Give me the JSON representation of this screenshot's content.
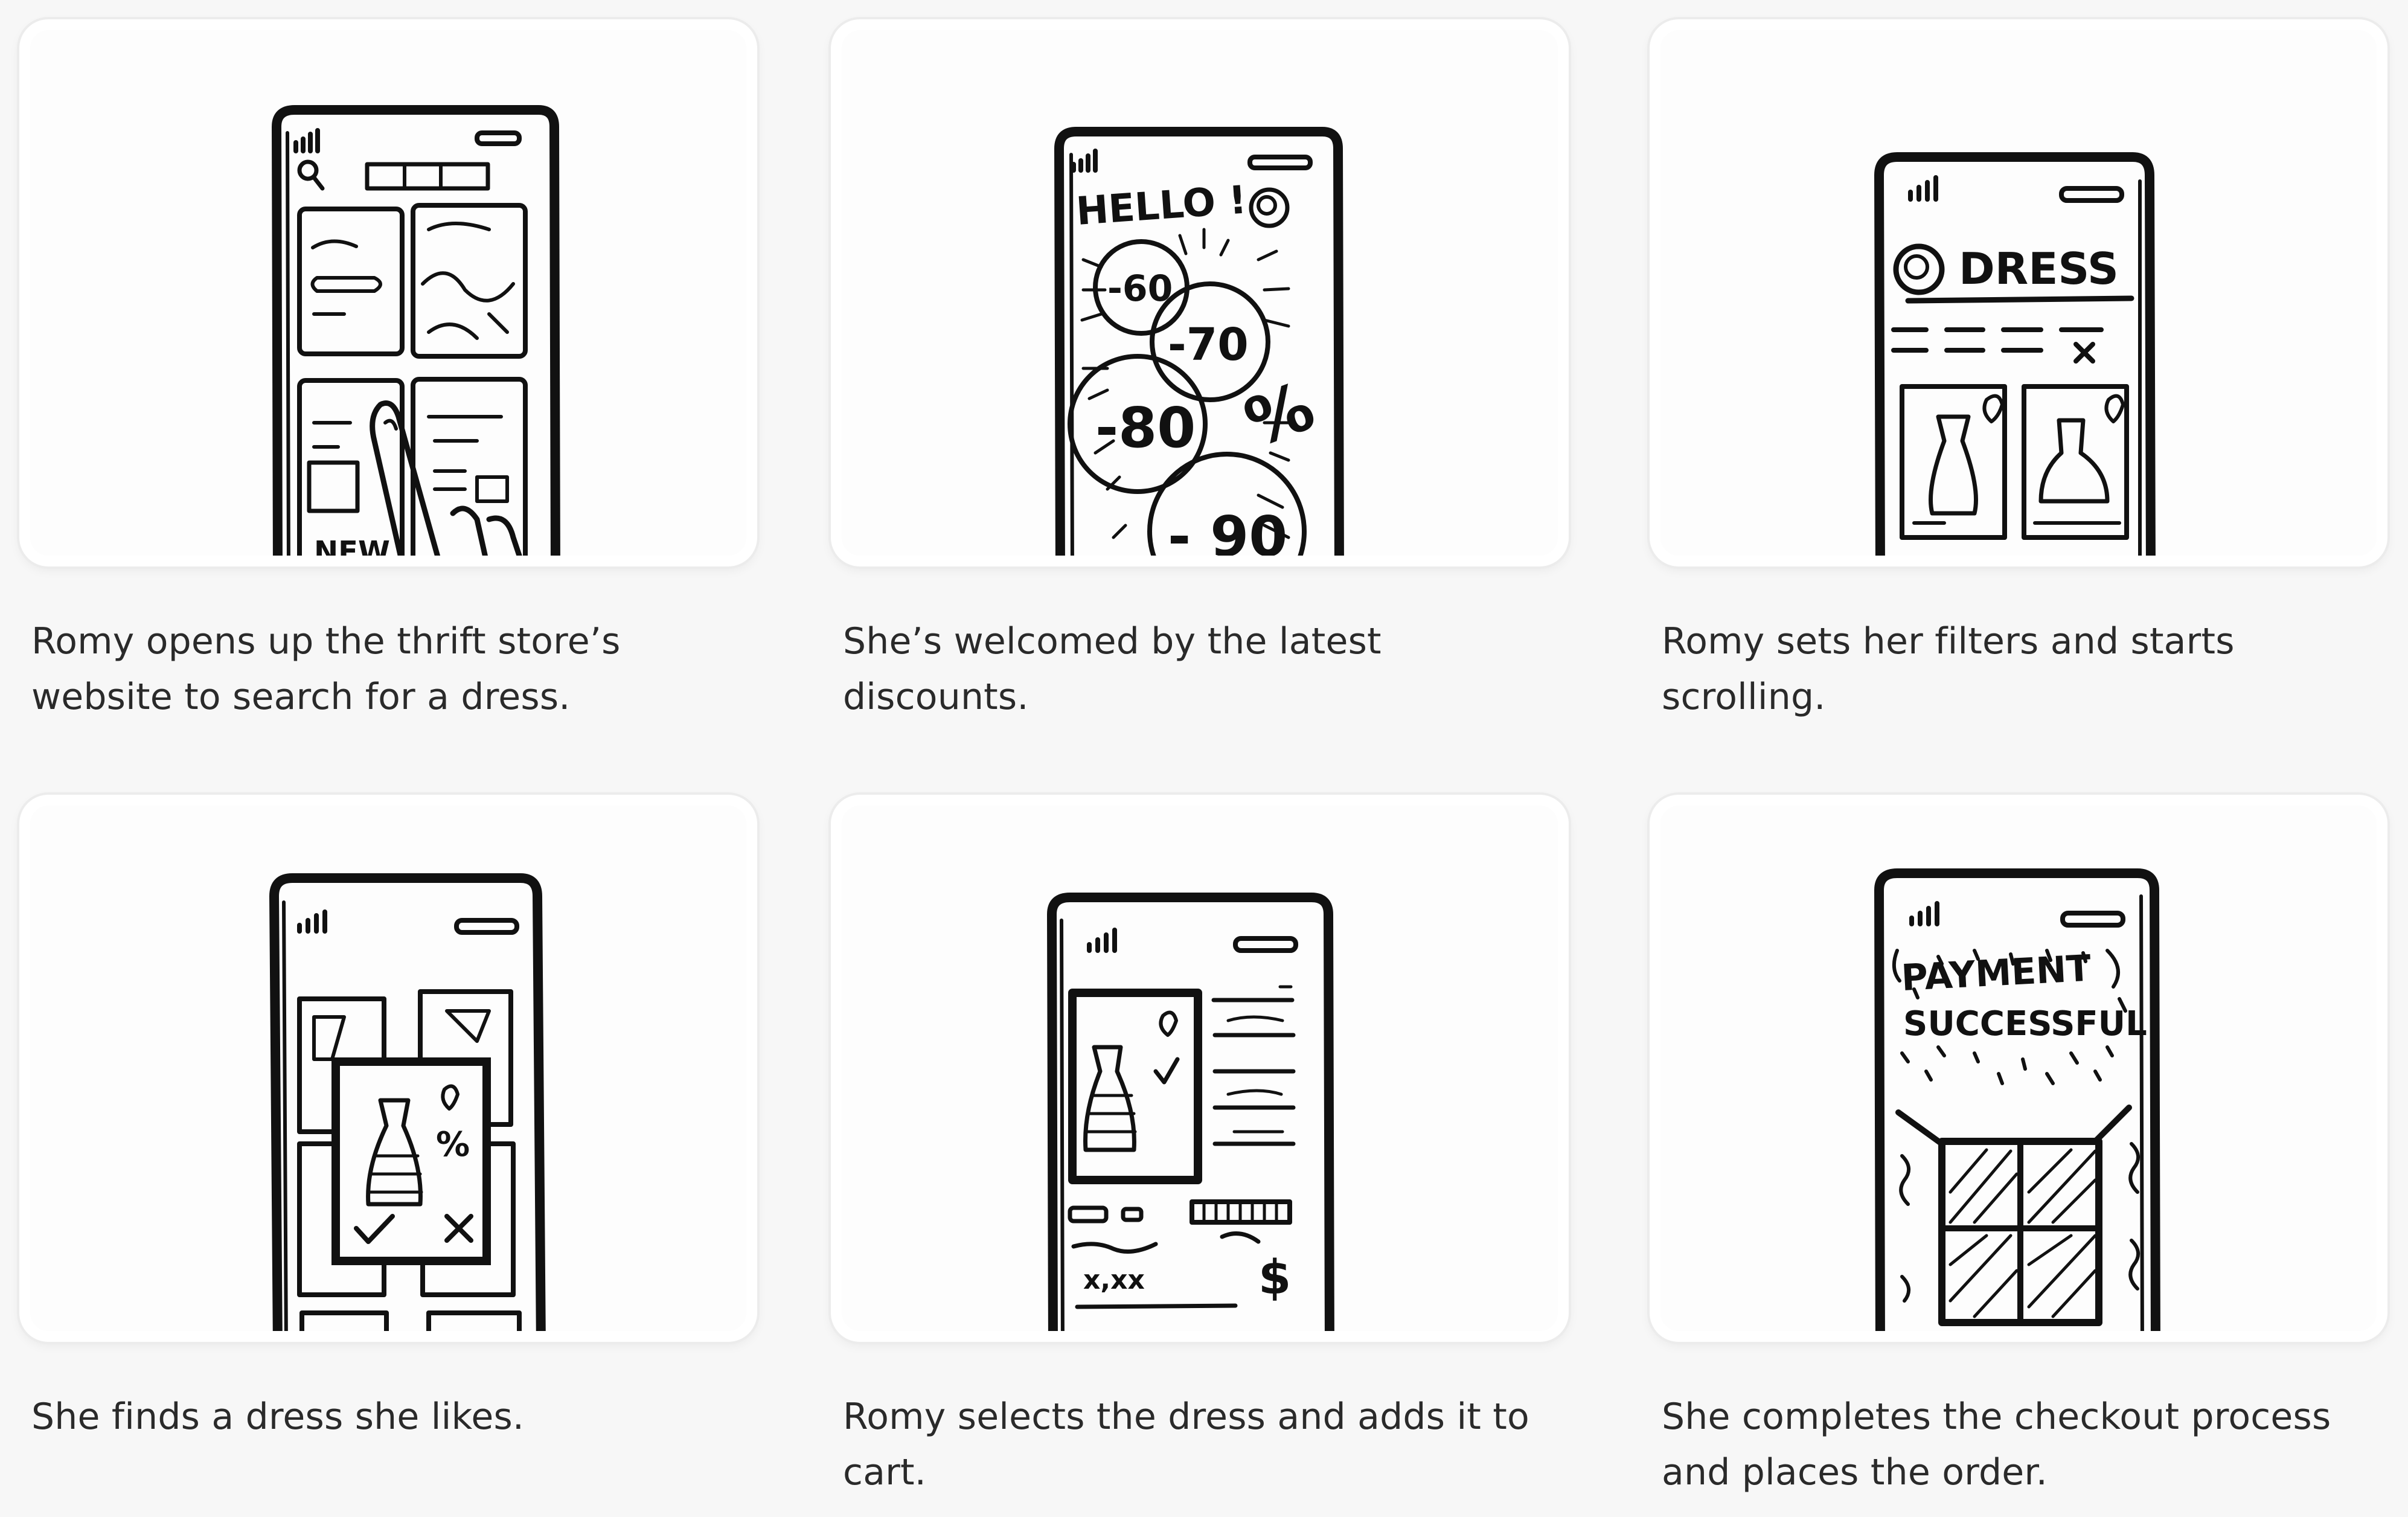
{
  "storyboard": {
    "frames": [
      {
        "caption": "Romy opens up the thrift store’s website to search for a dress.",
        "sketch": "phone-home-icon"
      },
      {
        "caption": "She’s welcomed by the latest discounts.",
        "sketch": "phone-discounts-icon",
        "sketch_text": {
          "greeting": "HELLO !",
          "d1": "-60",
          "d2": "-70",
          "d3": "-80",
          "d4": "- 90",
          "pct": "%"
        }
      },
      {
        "caption": "Romy sets her filters and starts scrolling.",
        "sketch": "phone-filters-icon",
        "sketch_text": {
          "search": "DRESS"
        }
      },
      {
        "caption": "She finds a dress she likes.",
        "sketch": "phone-dress-card-icon"
      },
      {
        "caption": "Romy selects the dress and adds it to cart.",
        "sketch": "phone-product-icon",
        "sketch_text": {
          "price": "x,xx",
          "currency": "$"
        }
      },
      {
        "caption": "She completes the checkout process and places the order.",
        "sketch": "phone-payment-icon",
        "sketch_text": {
          "line1": "PAYMENT",
          "line2": "SUCCESSFUL"
        }
      }
    ]
  }
}
